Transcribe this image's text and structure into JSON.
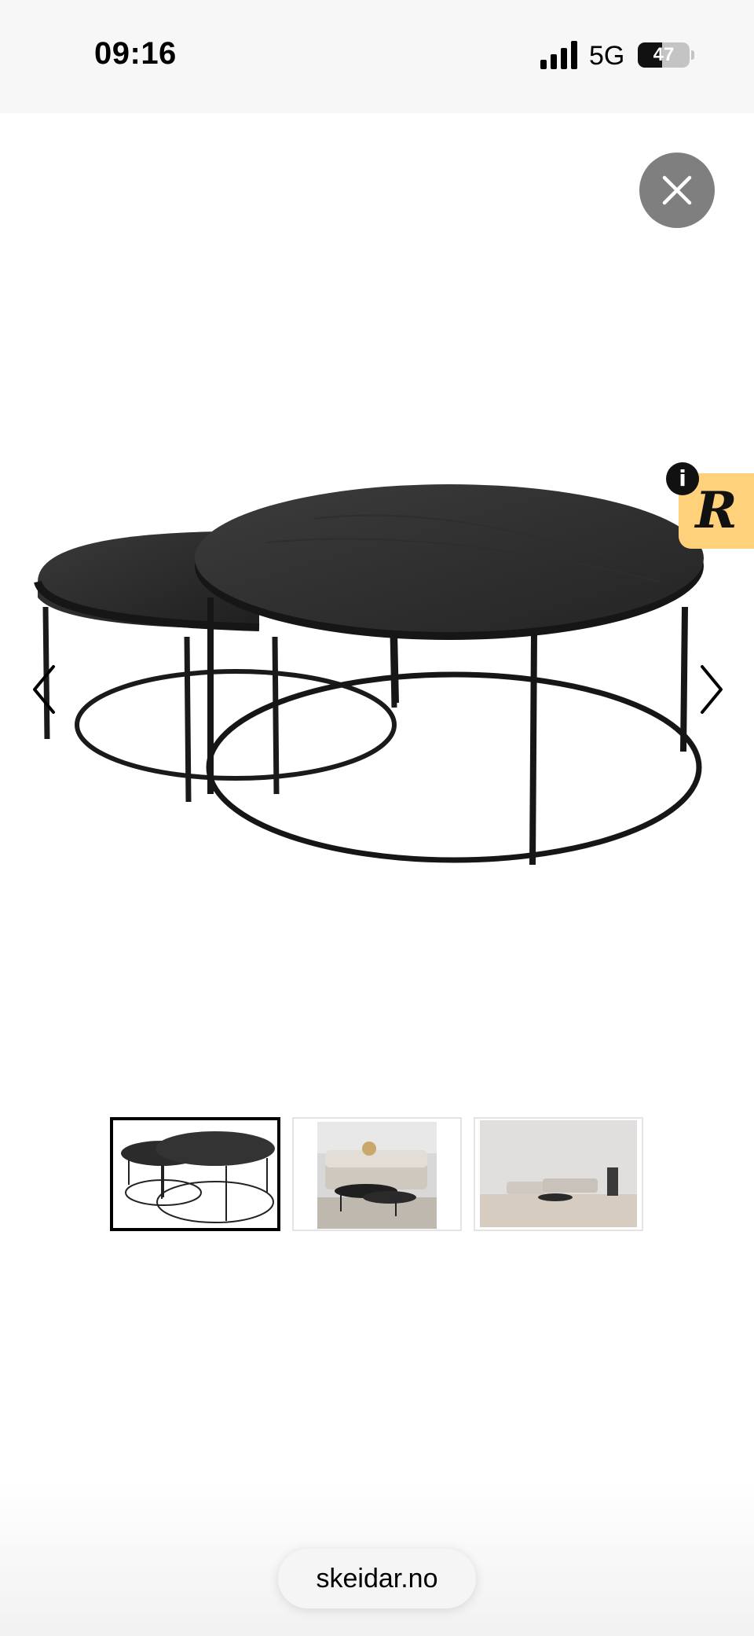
{
  "status_bar": {
    "time": "09:16",
    "network": "5G",
    "battery_percent": 47,
    "battery_label": "47",
    "signal_icon": "cellular-signal-icon"
  },
  "controls": {
    "close_icon": "close-icon",
    "prev_icon": "chevron-left-icon",
    "next_icon": "chevron-right-icon"
  },
  "badge": {
    "letter": "R",
    "info_symbol": "i",
    "color": "#ffd17a"
  },
  "gallery": {
    "thumbnails": [
      {
        "subject": "nesting tables product shot",
        "selected": true
      },
      {
        "subject": "living room with sofa and tables",
        "selected": false
      },
      {
        "subject": "wide living room with corner sofa",
        "selected": false
      }
    ]
  },
  "browser": {
    "url": "skeidar.no"
  }
}
